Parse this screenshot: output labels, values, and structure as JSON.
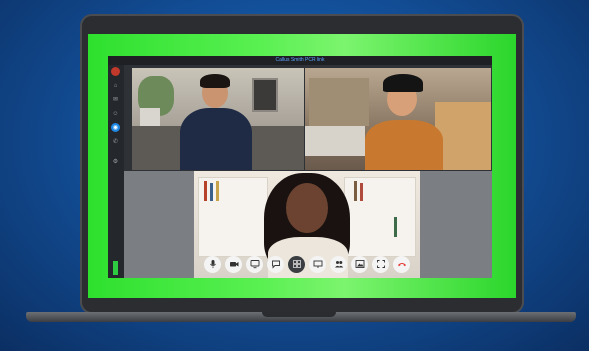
{
  "window": {
    "title": "Callus Smith PCR link"
  },
  "sidebar": {
    "items": [
      {
        "icon": "avatar"
      },
      {
        "icon": "home-icon"
      },
      {
        "icon": "chat-icon"
      },
      {
        "icon": "team-icon"
      },
      {
        "icon": "calls-icon",
        "active": true
      },
      {
        "icon": "phone-icon"
      },
      {
        "icon": "settings-icon"
      }
    ]
  },
  "participants": [
    {
      "id": "participant-1"
    },
    {
      "id": "participant-2"
    },
    {
      "id": "participant-3"
    }
  ],
  "controls": [
    {
      "name": "mic-button",
      "icon": "mic-icon"
    },
    {
      "name": "camera-button",
      "icon": "camera-icon"
    },
    {
      "name": "share-screen-button",
      "icon": "monitor-icon"
    },
    {
      "name": "chat-button",
      "icon": "chat-bubble-icon"
    },
    {
      "name": "layout-button",
      "icon": "grid-icon"
    },
    {
      "name": "whiteboard-button",
      "icon": "screen-icon"
    },
    {
      "name": "participants-button",
      "icon": "people-icon"
    },
    {
      "name": "image-button",
      "icon": "image-icon"
    },
    {
      "name": "fullscreen-button",
      "icon": "expand-icon"
    },
    {
      "name": "end-call-button",
      "icon": "hangup-icon"
    }
  ],
  "colors": {
    "frame_green": "#3fe63a",
    "background_blue": "#1b63b3",
    "end_call_red": "#e53935",
    "title_text": "#5ea6ff"
  }
}
